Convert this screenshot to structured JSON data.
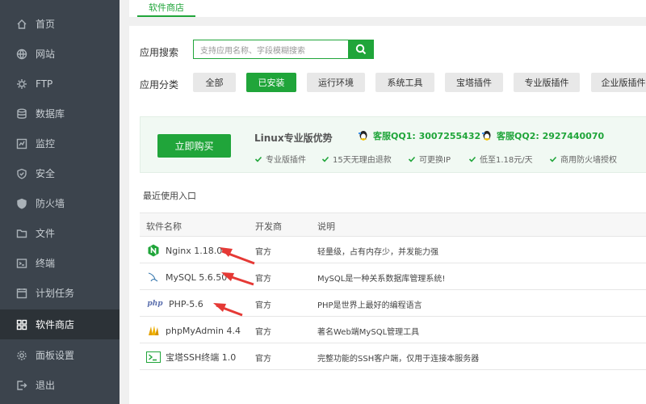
{
  "sidebar": {
    "items": [
      {
        "label": "首页",
        "icon": "home-icon"
      },
      {
        "label": "网站",
        "icon": "globe-icon"
      },
      {
        "label": "FTP",
        "icon": "ftp-icon"
      },
      {
        "label": "数据库",
        "icon": "database-icon"
      },
      {
        "label": "监控",
        "icon": "monitor-icon"
      },
      {
        "label": "安全",
        "icon": "shield-icon"
      },
      {
        "label": "防火墙",
        "icon": "firewall-icon"
      },
      {
        "label": "文件",
        "icon": "folder-icon"
      },
      {
        "label": "终端",
        "icon": "terminal-icon"
      },
      {
        "label": "计划任务",
        "icon": "clock-icon"
      },
      {
        "label": "软件商店",
        "icon": "apps-icon",
        "active": true
      },
      {
        "label": "面板设置",
        "icon": "gear-icon"
      },
      {
        "label": "退出",
        "icon": "logout-icon"
      }
    ]
  },
  "header": {
    "tab_label": "软件商店"
  },
  "search": {
    "label": "应用搜索",
    "placeholder": "支持应用名称、字段模糊搜索"
  },
  "categories": {
    "label": "应用分类",
    "items": [
      "全部",
      "已安装",
      "运行环境",
      "系统工具",
      "宝塔插件",
      "专业版插件",
      "企业版插件"
    ],
    "active": "已安装"
  },
  "promo": {
    "buy_label": "立即购买",
    "title": "Linux专业版优势",
    "qq1": "客服QQ1: 3007255432",
    "qq2": "客服QQ2: 2927440070",
    "features": [
      "专业版插件",
      "15天无理由退款",
      "可更换IP",
      "低至1.18元/天",
      "商用防火墙授权"
    ]
  },
  "recent_label": "最近使用入口",
  "table": {
    "headers": [
      "软件名称",
      "开发商",
      "说明"
    ],
    "rows": [
      {
        "name": "Nginx 1.18.0",
        "icon": "nginx-icon",
        "dev": "官方",
        "desc": "轻量级，占有内存少，并发能力强"
      },
      {
        "name": "MySQL 5.6.50",
        "icon": "mysql-icon",
        "dev": "官方",
        "desc": "MySQL是一种关系数据库管理系统!"
      },
      {
        "name": "PHP-5.6",
        "icon": "php-icon",
        "dev": "官方",
        "desc": "PHP是世界上最好的编程语言"
      },
      {
        "name": "phpMyAdmin 4.4",
        "icon": "phpmyadmin-icon",
        "dev": "官方",
        "desc": "著名Web端MySQL管理工具"
      },
      {
        "name": "宝塔SSH终端 1.0",
        "icon": "ssh-terminal-icon",
        "dev": "官方",
        "desc": "完整功能的SSH客户端，仅用于连接本服务器"
      }
    ]
  },
  "colors": {
    "accent": "#20a53a",
    "sidebar_bg": "#3c444d",
    "annotation": "#e53935"
  }
}
